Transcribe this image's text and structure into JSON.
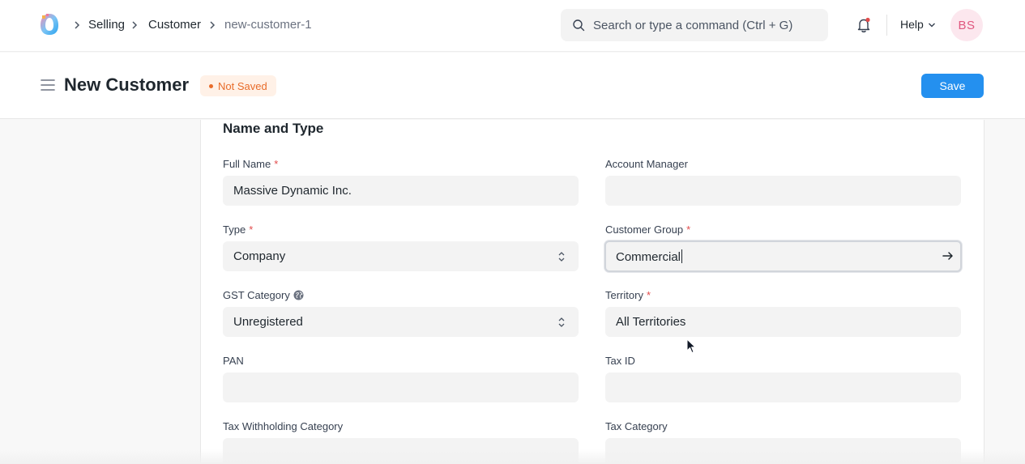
{
  "breadcrumbs": [
    {
      "label": "Selling"
    },
    {
      "label": "Customer"
    },
    {
      "label": "new-customer-1"
    }
  ],
  "search": {
    "placeholder": "Search or type a command (Ctrl + G)"
  },
  "navbar": {
    "help_label": "Help",
    "avatar_initials": "BS"
  },
  "page": {
    "title": "New Customer",
    "status": "Not Saved",
    "save_label": "Save"
  },
  "section": {
    "title": "Name and Type"
  },
  "fields": {
    "full_name": {
      "label": "Full Name",
      "value": "Massive Dynamic Inc.",
      "required": true
    },
    "account_manager": {
      "label": "Account Manager",
      "value": ""
    },
    "type": {
      "label": "Type",
      "value": "Company",
      "required": true
    },
    "customer_group": {
      "label": "Customer Group",
      "value": "Commercial",
      "required": true
    },
    "gst_category": {
      "label": "GST Category",
      "value": "Unregistered"
    },
    "territory": {
      "label": "Territory",
      "value": "All Territories",
      "required": true
    },
    "pan": {
      "label": "PAN",
      "value": ""
    },
    "tax_id": {
      "label": "Tax ID",
      "value": ""
    },
    "tax_withholding_category": {
      "label": "Tax Withholding Category",
      "value": ""
    },
    "tax_category": {
      "label": "Tax Category",
      "value": ""
    }
  },
  "required_marker": "*",
  "colors": {
    "accent": "#2490ef",
    "status": "#e86c2a",
    "required": "#e24c4c"
  },
  "icons": [
    "app-logo-icon",
    "chevron-right-icon",
    "search-icon",
    "bell-icon",
    "chevron-down-icon",
    "menu-icon",
    "globe-icon",
    "select-updown-icon",
    "arrow-right-icon",
    "mouse-pointer-icon"
  ]
}
